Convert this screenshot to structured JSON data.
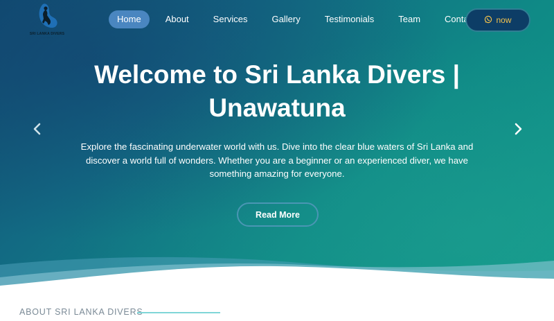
{
  "logo": {
    "name": "SRI LANKA DIVERS",
    "icon": "diver-logo-icon"
  },
  "nav": {
    "items": [
      {
        "label": "Home",
        "active": true
      },
      {
        "label": "About",
        "active": false
      },
      {
        "label": "Services",
        "active": false
      },
      {
        "label": "Gallery",
        "active": false
      },
      {
        "label": "Testimonials",
        "active": false
      },
      {
        "label": "Team",
        "active": false
      },
      {
        "label": "Contact",
        "active": false
      }
    ]
  },
  "whatsapp": {
    "label": "now",
    "icon": "whatsapp-icon"
  },
  "hero": {
    "title": "Welcome to Sri Lanka Divers | Unawatuna",
    "description": "Explore the fascinating underwater world with us. Dive into the clear blue waters of Sri Lanka and discover a world full of wonders. Whether you are a beginner or an experienced diver, we have something amazing for everyone.",
    "cta_label": "Read More",
    "prev_icon": "chevron-left-icon",
    "next_icon": "chevron-right-icon"
  },
  "about": {
    "label": "ABOUT SRI LANKA DIVERS"
  },
  "colors": {
    "hero_gradient_start": "#0f4f72",
    "hero_gradient_end": "#11988a",
    "nav_active": "#4a86c0",
    "whatsapp_bg": "#0d3d66",
    "whatsapp_text": "#f2c14e",
    "about_accent": "#7fd6d8"
  }
}
